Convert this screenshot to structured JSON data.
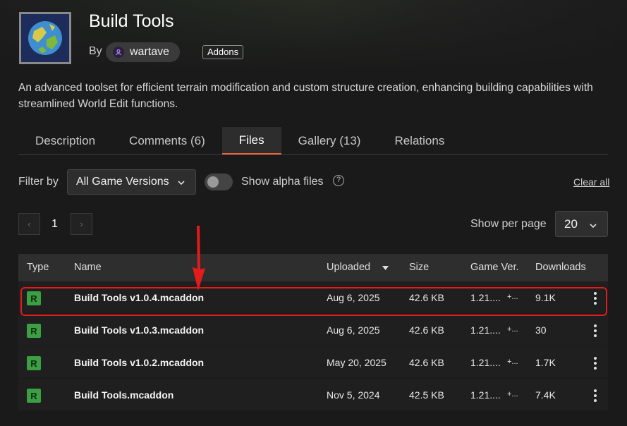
{
  "project": {
    "title": "Build Tools",
    "by_label": "By",
    "author": "wartave",
    "category_badge": "Addons",
    "description": "An advanced toolset for efficient terrain modification and custom structure creation, enhancing building capabilities with streamlined World Edit functions."
  },
  "tabs": [
    {
      "label": "Description",
      "active": false
    },
    {
      "label": "Comments (6)",
      "active": false
    },
    {
      "label": "Files",
      "active": true
    },
    {
      "label": "Gallery (13)",
      "active": false
    },
    {
      "label": "Relations",
      "active": false
    }
  ],
  "filters": {
    "filter_by_label": "Filter by",
    "game_version_selected": "All Game Versions",
    "show_alpha_label": "Show alpha files",
    "show_alpha_enabled": false,
    "help_glyph": "?",
    "clear_all_label": "Clear all"
  },
  "pagination": {
    "prev_glyph": "‹",
    "next_glyph": "›",
    "current_page": "1",
    "per_page_label": "Show per page",
    "per_page_value": "20"
  },
  "table": {
    "headers": {
      "type": "Type",
      "name": "Name",
      "uploaded": "Uploaded",
      "size": "Size",
      "game_ver": "Game Ver.",
      "downloads": "Downloads"
    },
    "rows": [
      {
        "type": "R",
        "name": "Build Tools v1.0.4.mcaddon",
        "uploaded": "Aug 6, 2025",
        "size": "42.6 KB",
        "game_ver": "1.21....",
        "game_ver_more": "+...",
        "downloads": "9.1K",
        "highlighted": true
      },
      {
        "type": "R",
        "name": "Build Tools v1.0.3.mcaddon",
        "uploaded": "Aug 6, 2025",
        "size": "42.6 KB",
        "game_ver": "1.21....",
        "game_ver_more": "+...",
        "downloads": "30",
        "highlighted": false
      },
      {
        "type": "R",
        "name": "Build Tools v1.0.2.mcaddon",
        "uploaded": "May 20, 2025",
        "size": "42.6 KB",
        "game_ver": "1.21....",
        "game_ver_more": "+...",
        "downloads": "1.7K",
        "highlighted": false
      },
      {
        "type": "R",
        "name": "Build Tools.mcaddon",
        "uploaded": "Nov 5, 2024",
        "size": "42.5 KB",
        "game_ver": "1.21....",
        "game_ver_more": "+...",
        "downloads": "7.4K",
        "highlighted": false
      }
    ]
  },
  "colors": {
    "background": "#1a1a1a",
    "accent_tab_underline": "#f16436",
    "release_badge": "#3aa043",
    "annotation_red": "#e31b1b"
  },
  "icons": {
    "author": "user-icon",
    "dropdown": "chevron-down-icon",
    "help": "question-circle-icon",
    "sort": "sort-down-icon",
    "row_menu": "more-vertical-icon",
    "annotation": "red-arrow-icon"
  }
}
